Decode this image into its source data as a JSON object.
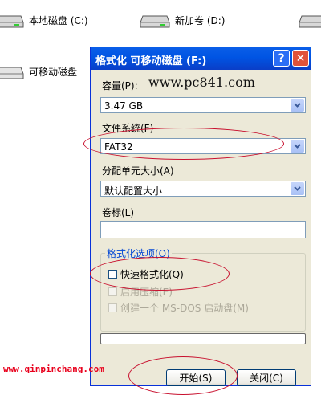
{
  "desktop": {
    "drives": [
      {
        "label": "本地磁盘 (C:)"
      },
      {
        "label": "新加卷 (D:)"
      },
      {
        "label": "可移动磁盘"
      }
    ]
  },
  "dialog": {
    "title": "格式化 可移动磁盘 (F:)",
    "help_label": "?",
    "close_label": "✕",
    "capacity_label": "容量(P):",
    "capacity_value": "3.47 GB",
    "filesystem_label": "文件系统(F)",
    "filesystem_value": "FAT32",
    "allocation_label": "分配单元大小(A)",
    "allocation_value": "默认配置大小",
    "volume_label": "卷标(L)",
    "volume_value": "",
    "options_title": "格式化选项(O)",
    "options": [
      {
        "label": "快速格式化(Q)",
        "checked": false,
        "enabled": true
      },
      {
        "label": "启用压缩(E)",
        "checked": false,
        "enabled": false
      },
      {
        "label": "创建一个 MS-DOS 启动盘(M)",
        "checked": false,
        "enabled": false
      }
    ],
    "progress_percent": 0,
    "start_label": "开始(S)",
    "close_button_label": "关闭(C)"
  },
  "watermarks": {
    "top": "www.pc841.com",
    "bottom": "www.qinpinchang.com"
  },
  "colors": {
    "accent_title": "#0054e3",
    "annotation": "#c8102e",
    "watermark_bottom": "#e8001c"
  }
}
